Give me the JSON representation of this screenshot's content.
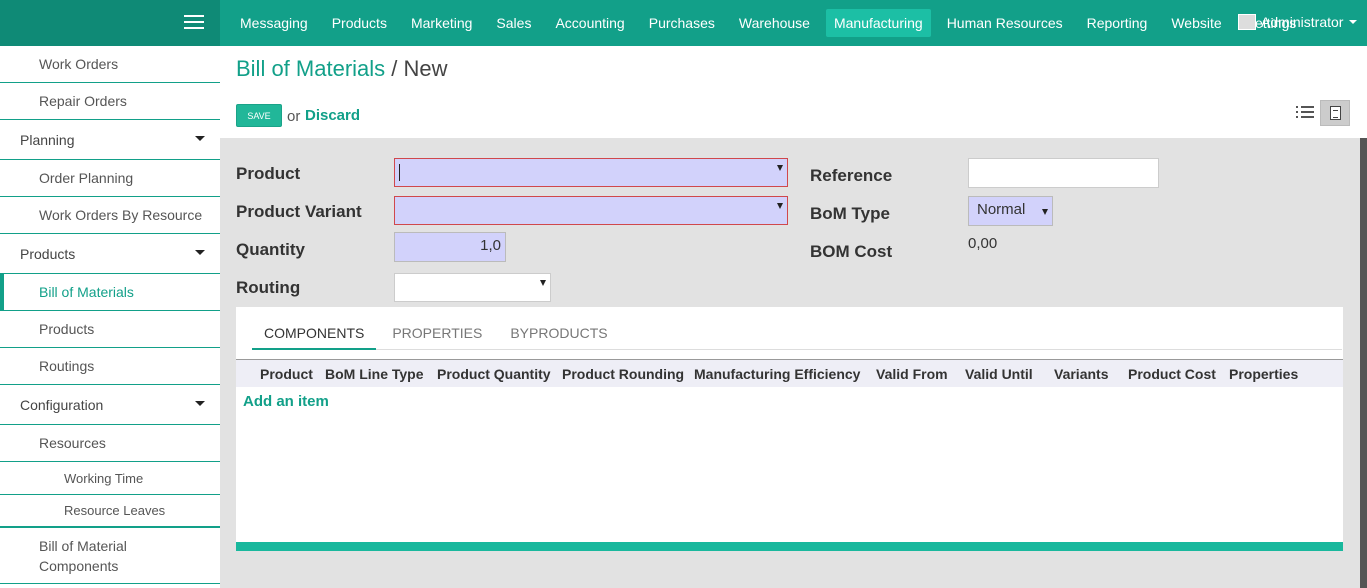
{
  "topbar": {
    "menu": [
      "Messaging",
      "Products",
      "Marketing",
      "Sales",
      "Accounting",
      "Purchases",
      "Warehouse",
      "Manufacturing",
      "Human Resources",
      "Reporting",
      "Website",
      "Settings"
    ],
    "active_menu": "Manufacturing",
    "user": "Administrator",
    "accent_color": "#12a089"
  },
  "sidebar": {
    "items": [
      {
        "label": "Work Orders",
        "level": "sub"
      },
      {
        "label": "Repair Orders",
        "level": "sub"
      },
      {
        "label": "Planning",
        "level": "section"
      },
      {
        "label": "Order Planning",
        "level": "sub"
      },
      {
        "label": "Work Orders By Resource",
        "level": "sub"
      },
      {
        "label": "Products",
        "level": "section"
      },
      {
        "label": "Bill of Materials",
        "level": "sub",
        "active": true
      },
      {
        "label": "Products",
        "level": "sub"
      },
      {
        "label": "Routings",
        "level": "sub"
      },
      {
        "label": "Configuration",
        "level": "section"
      },
      {
        "label": "Resources",
        "level": "sub"
      },
      {
        "label": "Working Time",
        "level": "subsub"
      },
      {
        "label": "Resource Leaves",
        "level": "subsub"
      },
      {
        "label": "Bill of Material Components",
        "level": "sub"
      }
    ]
  },
  "header": {
    "breadcrumb_parent": "Bill of Materials",
    "breadcrumb_sep": "/",
    "breadcrumb_current": "New",
    "save_label": "SAVE",
    "or_label": "or",
    "discard_label": "Discard"
  },
  "form": {
    "product_label": "Product",
    "product_value": "",
    "product_variant_label": "Product Variant",
    "product_variant_value": "",
    "quantity_label": "Quantity",
    "quantity_value": "1,0",
    "routing_label": "Routing",
    "routing_value": "",
    "reference_label": "Reference",
    "reference_value": "",
    "bom_type_label": "BoM Type",
    "bom_type_value": "Normal",
    "bom_cost_label": "BOM Cost",
    "bom_cost_value": "0,00"
  },
  "notebook": {
    "tabs": [
      "COMPONENTS",
      "PROPERTIES",
      "BYPRODUCTS"
    ],
    "active_tab": "COMPONENTS",
    "columns": [
      "Product",
      "BoM Line Type",
      "Product Quantity",
      "Product Rounding",
      "Manufacturing Efficiency",
      "Valid From",
      "Valid Until",
      "Variants",
      "Product Cost",
      "Properties"
    ],
    "add_item_label": "Add an item"
  }
}
